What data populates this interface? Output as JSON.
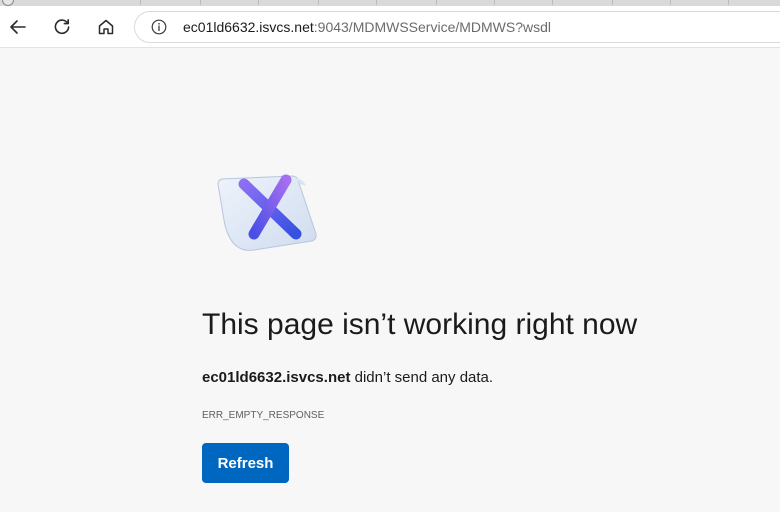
{
  "browser": {
    "nav": {
      "back_icon": "arrow-left-icon",
      "reload_icon": "refresh-icon",
      "home_icon": "home-icon"
    },
    "address": {
      "info_icon": "info-icon",
      "url_host": "ec01ld6632.isvcs.net",
      "url_rest": ":9043/MDMWSService/MDMWS?wsdl"
    }
  },
  "error_page": {
    "illustration_icon": "error-x-page-icon",
    "title": "This page isn’t working right now",
    "message_host": "ec01ld6632.isvcs.net",
    "message_text": " didn’t send any data.",
    "error_code": "ERR_EMPTY_RESPONSE",
    "refresh_label": "Refresh"
  },
  "colors": {
    "accent": "#0067c0",
    "page_background": "#f7f7f7",
    "x_gradient_start": "#7b6cf6",
    "x_gradient_end": "#3b4fe0"
  }
}
